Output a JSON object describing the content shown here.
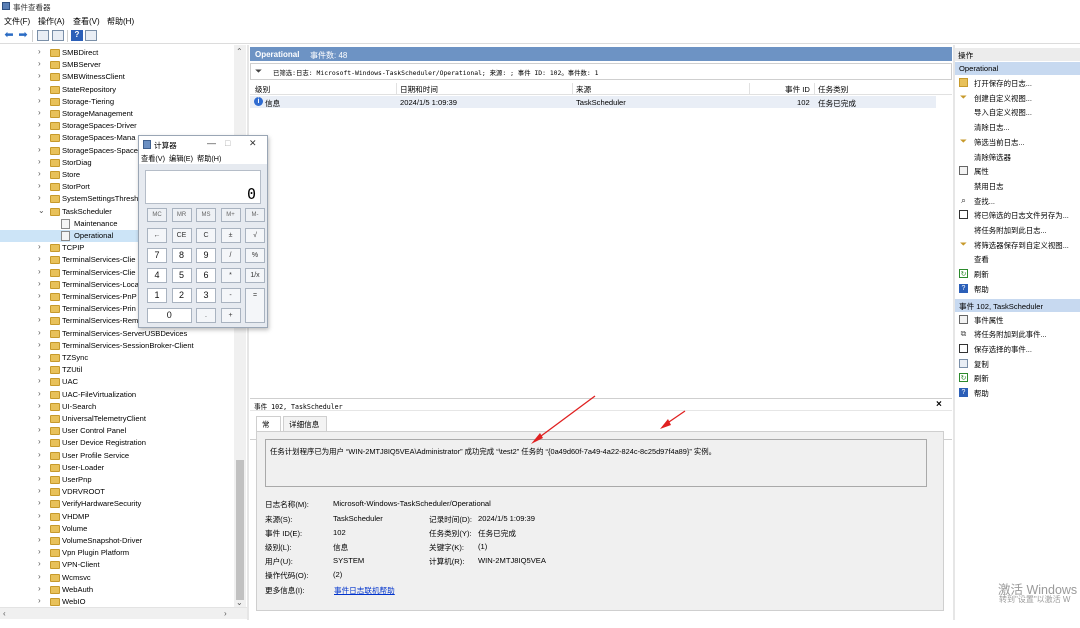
{
  "window": {
    "title": "事件查看器"
  },
  "menu": [
    "文件(F)",
    "操作(A)",
    "查看(V)",
    "帮助(H)"
  ],
  "toolbar": {
    "back": "⬅",
    "forward": "➡",
    "help": "?"
  },
  "tree": {
    "items": [
      {
        "label": "SMBDirect",
        "type": "folder"
      },
      {
        "label": "SMBServer",
        "type": "folder"
      },
      {
        "label": "SMBWitnessClient",
        "type": "folder"
      },
      {
        "label": "StateRepository",
        "type": "folder"
      },
      {
        "label": "Storage-Tiering",
        "type": "folder"
      },
      {
        "label": "StorageManagement",
        "type": "folder"
      },
      {
        "label": "StorageSpaces-Driver",
        "type": "folder"
      },
      {
        "label": "StorageSpaces-Mana",
        "type": "folder"
      },
      {
        "label": "StorageSpaces-Space",
        "type": "folder"
      },
      {
        "label": "StorDiag",
        "type": "folder"
      },
      {
        "label": "Store",
        "type": "folder"
      },
      {
        "label": "StorPort",
        "type": "folder"
      },
      {
        "label": "SystemSettingsThresh",
        "type": "folder"
      },
      {
        "label": "TaskScheduler",
        "type": "folder-open"
      },
      {
        "label": "Maintenance",
        "type": "log"
      },
      {
        "label": "Operational",
        "type": "log-selected"
      },
      {
        "label": "TCPIP",
        "type": "folder"
      },
      {
        "label": "TerminalServices-Clie",
        "type": "folder"
      },
      {
        "label": "TerminalServices-Clie",
        "type": "folder"
      },
      {
        "label": "TerminalServices-Loca",
        "type": "folder"
      },
      {
        "label": "TerminalServices-PnP",
        "type": "folder"
      },
      {
        "label": "TerminalServices-Prin",
        "type": "folder"
      },
      {
        "label": "TerminalServices-Rem",
        "type": "folder"
      },
      {
        "label": "TerminalServices-ServerUSBDevices",
        "type": "folder"
      },
      {
        "label": "TerminalServices-SessionBroker-Client",
        "type": "folder"
      },
      {
        "label": "TZSync",
        "type": "folder"
      },
      {
        "label": "TZUtil",
        "type": "folder"
      },
      {
        "label": "UAC",
        "type": "folder"
      },
      {
        "label": "UAC-FileVirtualization",
        "type": "folder"
      },
      {
        "label": "UI-Search",
        "type": "folder"
      },
      {
        "label": "UniversalTelemetryClient",
        "type": "folder"
      },
      {
        "label": "User Control Panel",
        "type": "folder"
      },
      {
        "label": "User Device Registration",
        "type": "folder"
      },
      {
        "label": "User Profile Service",
        "type": "folder"
      },
      {
        "label": "User-Loader",
        "type": "folder"
      },
      {
        "label": "UserPnp",
        "type": "folder"
      },
      {
        "label": "VDRVROOT",
        "type": "folder"
      },
      {
        "label": "VerifyHardwareSecurity",
        "type": "folder"
      },
      {
        "label": "VHDMP",
        "type": "folder"
      },
      {
        "label": "Volume",
        "type": "folder"
      },
      {
        "label": "VolumeSnapshot-Driver",
        "type": "folder"
      },
      {
        "label": "Vpn Plugin Platform",
        "type": "folder"
      },
      {
        "label": "VPN-Client",
        "type": "folder"
      },
      {
        "label": "Wcmsvc",
        "type": "folder"
      },
      {
        "label": "WebAuth",
        "type": "folder"
      },
      {
        "label": "WebIO",
        "type": "folder"
      }
    ]
  },
  "center": {
    "header_title": "Operational",
    "header_count": "事件数: 48",
    "filter_text": "已筛选:日志: Microsoft-Windows-TaskScheduler/Operational; 来源: ; 事件 ID: 102。事件数: 1",
    "columns": [
      "级别",
      "日期和时间",
      "来源",
      "事件 ID",
      "任务类别"
    ],
    "row": {
      "level": "信息",
      "datetime": "2024/1/5 1:09:39",
      "source": "TaskScheduler",
      "event_id": "102",
      "category": "任务已完成"
    },
    "detail_title": "事件 102, TaskScheduler",
    "tabs": [
      "常规",
      "详细信息"
    ],
    "description": "任务计划程序已为用户 “WIN-2MTJ8IQ5VEA\\Administrator” 成功完成 “\\test2” 任务的 “{0a49d60f-7a49-4a22-824c-8c25d97f4a89}” 实例。",
    "fields": {
      "log_name_label": "日志名称(M):",
      "log_name": "Microsoft-Windows-TaskScheduler/Operational",
      "source_label": "来源(S):",
      "source": "TaskScheduler",
      "logged_label": "记录时间(D):",
      "logged": "2024/1/5 1:09:39",
      "event_id_label": "事件 ID(E):",
      "event_id": "102",
      "task_cat_label": "任务类别(Y):",
      "task_cat": "任务已完成",
      "level_label": "级别(L):",
      "level": "信息",
      "keywords_label": "关键字(K):",
      "keywords": "(1)",
      "user_label": "用户(U):",
      "user": "SYSTEM",
      "computer_label": "计算机(R):",
      "computer": "WIN-2MTJ8IQ5VEA",
      "opcode_label": "操作代码(O):",
      "opcode": "(2)",
      "more_info_label": "更多信息(I):",
      "more_info": "事件日志联机帮助"
    }
  },
  "actions": {
    "title": "操作",
    "section1": "Operational",
    "items1": [
      {
        "label": "打开保存的日志...",
        "icon": "folder-icon"
      },
      {
        "label": "创建自定义视图...",
        "icon": "filter-icon"
      },
      {
        "label": "导入自定义视图...",
        "icon": ""
      },
      {
        "label": "清除日志...",
        "icon": ""
      },
      {
        "label": "筛选当前日志...",
        "icon": "filter-icon"
      },
      {
        "label": "清除筛选器",
        "icon": ""
      },
      {
        "label": "属性",
        "icon": "properties-icon"
      },
      {
        "label": "禁用日志",
        "icon": ""
      },
      {
        "label": "查找...",
        "icon": "find-icon"
      },
      {
        "label": "将已筛选的日志文件另存为...",
        "icon": "save-icon"
      },
      {
        "label": "将任务附加到此日志...",
        "icon": ""
      },
      {
        "label": "将筛选器保存到自定义视图...",
        "icon": "filter-icon"
      },
      {
        "label": "查看",
        "icon": ""
      },
      {
        "label": "刷新",
        "icon": "refresh-icon"
      },
      {
        "label": "帮助",
        "icon": "help-icon"
      }
    ],
    "section2": "事件 102, TaskScheduler",
    "items2": [
      {
        "label": "事件属性",
        "icon": "properties-icon"
      },
      {
        "label": "将任务附加到此事件...",
        "icon": "attach-icon"
      },
      {
        "label": "保存选择的事件...",
        "icon": "save-icon"
      },
      {
        "label": "复制",
        "icon": "copy-icon"
      },
      {
        "label": "刷新",
        "icon": "refresh-icon"
      },
      {
        "label": "帮助",
        "icon": "help-icon"
      }
    ]
  },
  "watermark": {
    "line1": "激活 Windows",
    "line2": "转到\"设置\"以激活 W"
  },
  "calculator": {
    "title": "计算器",
    "menu": [
      "查看(V)",
      "编辑(E)",
      "帮助(H)"
    ],
    "display": "0",
    "mem_keys": [
      "MC",
      "MR",
      "MS",
      "M+",
      "M-"
    ],
    "rows": [
      [
        "←",
        "CE",
        "C",
        "±",
        "√"
      ],
      [
        "7",
        "8",
        "9",
        "/",
        "%"
      ],
      [
        "4",
        "5",
        "6",
        "*",
        "1/x"
      ],
      [
        "1",
        "2",
        "3",
        "-",
        "="
      ],
      [
        "0",
        ".",
        "+"
      ]
    ],
    "controls": [
      "—",
      "□",
      "✕"
    ]
  },
  "colors": {
    "accent": "#6d93c4",
    "selection": "#cce4f7",
    "link": "#0033cc"
  }
}
